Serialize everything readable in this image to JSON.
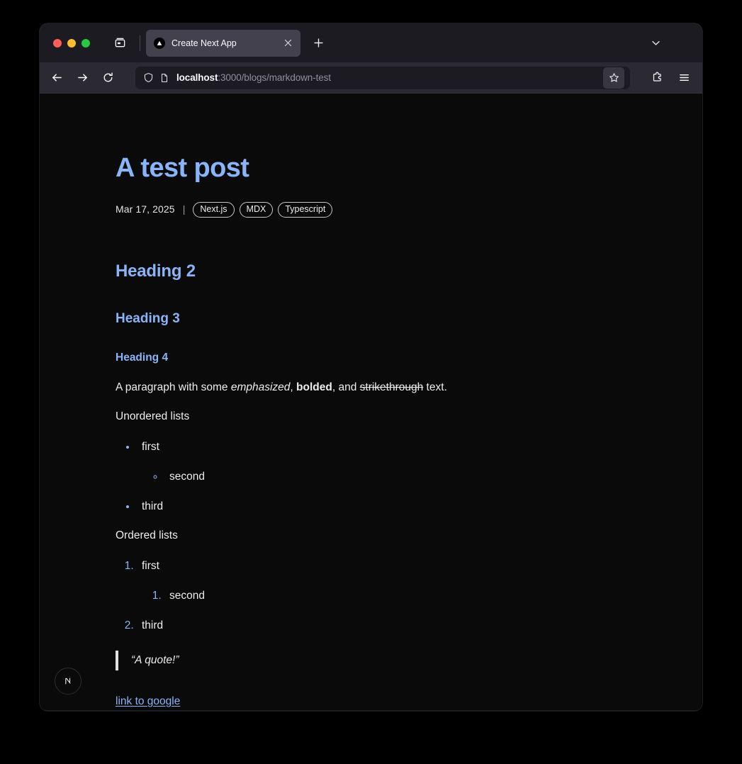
{
  "window": {
    "traffic_lights": [
      "close",
      "minimize",
      "zoom"
    ],
    "colors": {
      "accent_blue": "#8ab4f8",
      "toolbar_bg": "#2b2a33",
      "tabstrip_bg": "#1c1b22",
      "page_bg": "#0a0a0a",
      "active_tab_bg": "#42414d",
      "text": "#ededed"
    }
  },
  "tabstrip": {
    "sidebar_toggle_icon": "list-all-tabs-icon",
    "new_tab_label": "+",
    "tab_list_chevron_icon": "chevron-down-icon",
    "active_tab": {
      "title": "Create Next App",
      "favicon": "nextjs-triangle-favicon",
      "close_label": "×"
    }
  },
  "toolbar": {
    "back_icon": "back-arrow-icon",
    "forward_icon": "forward-arrow-icon",
    "reload_icon": "reload-icon",
    "shield_icon": "shield-icon",
    "page_icon": "page-document-icon",
    "bookmark_icon": "star-icon",
    "extensions_icon": "puzzle-piece-icon",
    "app_menu_icon": "hamburger-menu-icon",
    "url": {
      "full": "localhost:3000/blogs/markdown-test",
      "host": "localhost",
      "path": ":3000/blogs/markdown-test"
    }
  },
  "article": {
    "title": "A test post",
    "date": "Mar 17, 2025",
    "meta_separator": "|",
    "tags": [
      "Next.js",
      "MDX",
      "Typescript"
    ],
    "heading2": "Heading 2",
    "heading3": "Heading 3",
    "heading4": "Heading 4",
    "paragraph": {
      "part1": "A paragraph with some ",
      "emphasized": "emphasized",
      "part2": ", ",
      "bolded": "bolded",
      "part3": ", and ",
      "strikethrough": "strikethrough",
      "part4": " text."
    },
    "unordered_label": "Unordered lists",
    "unordered_items": {
      "first": "first",
      "second": "second",
      "third": "third"
    },
    "ordered_label": "Ordered lists",
    "ordered_items": {
      "first": "first",
      "second": "second",
      "third": "third"
    },
    "blockquote": "“A quote!”",
    "link_text": "link to google"
  },
  "dev_badge": {
    "icon": "nextjs-logo-icon",
    "label": "N"
  }
}
